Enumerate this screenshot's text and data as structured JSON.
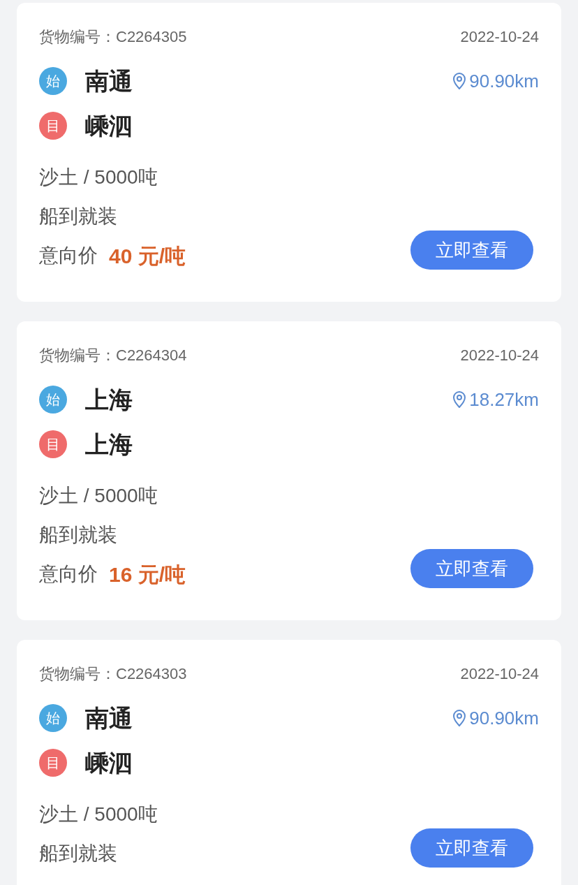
{
  "cards": [
    {
      "cargo_no_label": "货物编号：",
      "cargo_no": "C2264305",
      "date": "2022-10-24",
      "stops": [
        {
          "kind": "start",
          "badge": "始",
          "city": "南通"
        },
        {
          "kind": "end",
          "badge": "目",
          "city": "嵊泗"
        }
      ],
      "distance": "90.90km",
      "cargo": "沙土 / 5000吨",
      "loading": "船到就装",
      "price": {
        "label": "意向价",
        "value": "40",
        "unit": "元/吨"
      },
      "button": "立即查看"
    },
    {
      "cargo_no_label": "货物编号：",
      "cargo_no": "C2264304",
      "date": "2022-10-24",
      "stops": [
        {
          "kind": "start",
          "badge": "始",
          "city": "上海"
        },
        {
          "kind": "end",
          "badge": "目",
          "city": "上海"
        }
      ],
      "distance": "18.27km",
      "cargo": "沙土 / 5000吨",
      "loading": "船到就装",
      "price": {
        "label": "意向价",
        "value": "16",
        "unit": "元/吨"
      },
      "button": "立即查看"
    },
    {
      "cargo_no_label": "货物编号：",
      "cargo_no": "C2264303",
      "date": "2022-10-24",
      "stops": [
        {
          "kind": "start",
          "badge": "始",
          "city": "南通"
        },
        {
          "kind": "end",
          "badge": "目",
          "city": "嵊泗"
        }
      ],
      "distance": "90.90km",
      "cargo": "沙土 / 5000吨",
      "loading": "船到就装",
      "button": "立即查看"
    }
  ]
}
